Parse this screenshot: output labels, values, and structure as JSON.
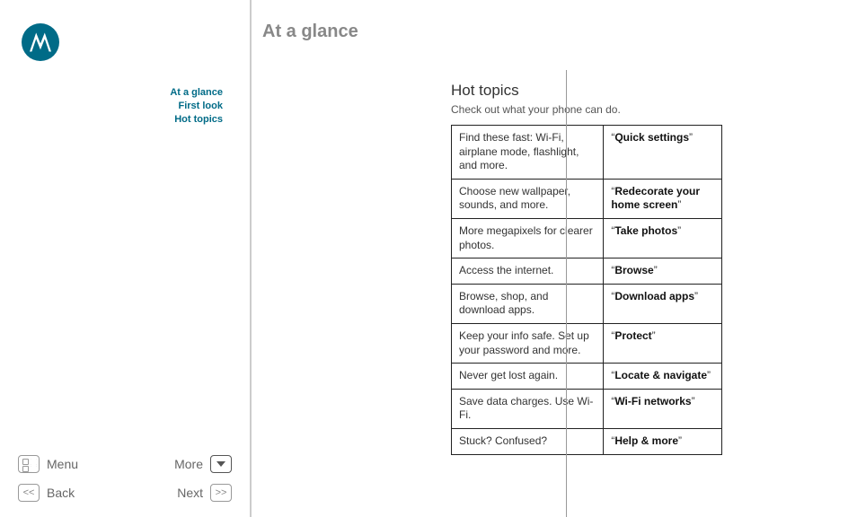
{
  "title": "At a glance",
  "crumbs": {
    "top": "At a glance",
    "sub1": "First look",
    "sub2": "Hot topics"
  },
  "nav": {
    "menu": "Menu",
    "more": "More",
    "back": "Back",
    "next": "Next"
  },
  "section": {
    "title": "Hot topics",
    "subtitle": "Check out what your phone can do."
  },
  "topics": [
    {
      "desc": "Find these fast: Wi-Fi, airplane mode, flashlight, and more.",
      "link": "Quick settings"
    },
    {
      "desc": "Choose new wallpaper, sounds, and more.",
      "link": "Redecorate your home screen"
    },
    {
      "desc": "More megapixels for clearer photos.",
      "link": "Take photos"
    },
    {
      "desc": "Access the internet.",
      "link": "Browse"
    },
    {
      "desc": "Browse, shop, and download apps.",
      "link": "Download apps"
    },
    {
      "desc": "Keep your info safe. Set up your password and more.",
      "link": "Protect"
    },
    {
      "desc": "Never get lost again.",
      "link": "Locate & navigate"
    },
    {
      "desc": "Save data charges. Use Wi-Fi.",
      "link": "Wi-Fi networks"
    },
    {
      "desc": "Stuck? Confused?",
      "link": "Help & more"
    }
  ]
}
